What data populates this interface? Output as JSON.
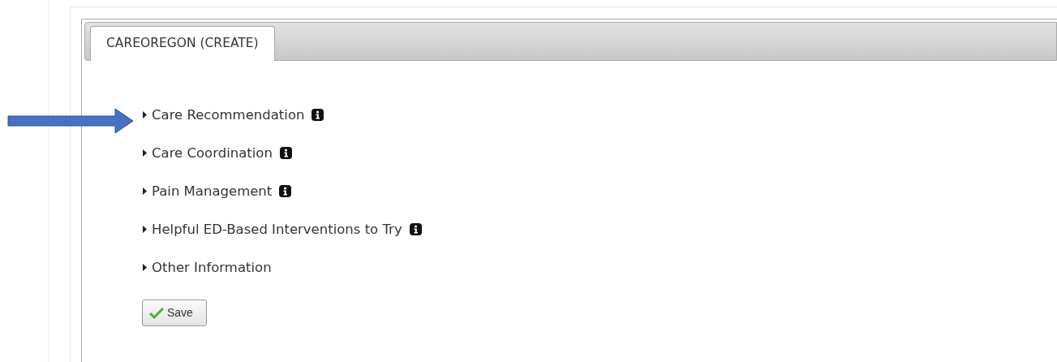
{
  "tabs": [
    {
      "label": "CAREOREGON (CREATE)",
      "selected": true
    }
  ],
  "sections": [
    {
      "label": "Care Recommendation",
      "expanded": false,
      "info": true,
      "pointed": true
    },
    {
      "label": "Care Coordination",
      "expanded": false,
      "info": true,
      "pointed": false
    },
    {
      "label": "Pain Management",
      "expanded": false,
      "info": true,
      "pointed": false
    },
    {
      "label": "Helpful ED-Based Interventions to Try",
      "expanded": false,
      "info": true,
      "pointed": false
    },
    {
      "label": "Other Information",
      "expanded": false,
      "info": false,
      "pointed": false
    }
  ],
  "save_button": {
    "label": "Save"
  }
}
